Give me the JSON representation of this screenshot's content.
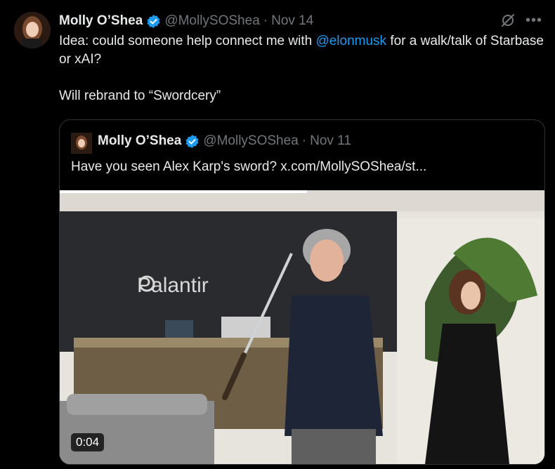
{
  "tweet": {
    "author_name": "Molly O’Shea",
    "handle": "@MollySOShea",
    "separator": "·",
    "date": "Nov 14",
    "text_before_mention": "Idea: could someone help connect me with ",
    "mention": "@elonmusk",
    "text_after_mention": " for a walk/talk of Starbase or xAI?",
    "second_line": "Will rebrand to “Swordcery”",
    "icons": [
      "verified-badge-icon",
      "grok-icon",
      "more-icon"
    ]
  },
  "quote": {
    "author_name": "Molly O’Shea",
    "handle": "@MollySOShea",
    "separator": "·",
    "date": "Nov 11",
    "text": "Have you seen Alex Karp's sword?  x.com/MollySOShea/st...",
    "media": {
      "wall_logo": "Palantir",
      "duration": "0:04",
      "progress": 0.51
    }
  },
  "colors": {
    "background": "#000000",
    "text": "#e7e9ea",
    "muted": "#71767b",
    "link": "#1d9bf0",
    "verified": "#1d9bf0",
    "border": "#2f3336"
  }
}
